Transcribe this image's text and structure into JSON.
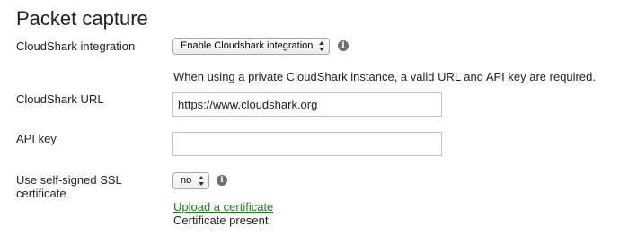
{
  "section": {
    "title": "Packet capture"
  },
  "cloudshark_integration": {
    "label": "CloudShark integration",
    "selected": "Enable Cloudshark integration",
    "hint": "When using a private CloudShark instance, a valid URL and API key are required."
  },
  "cloudshark_url": {
    "label": "CloudShark URL",
    "value": "https://www.cloudshark.org"
  },
  "api_key": {
    "label": "API key",
    "value": ""
  },
  "ssl": {
    "label": "Use self-signed SSL certificate",
    "selected": "no",
    "upload_link": "Upload a certificate",
    "status": "Certificate present"
  },
  "colors": {
    "link": "#1f7f1f",
    "info_icon": "#6f6f6f"
  }
}
